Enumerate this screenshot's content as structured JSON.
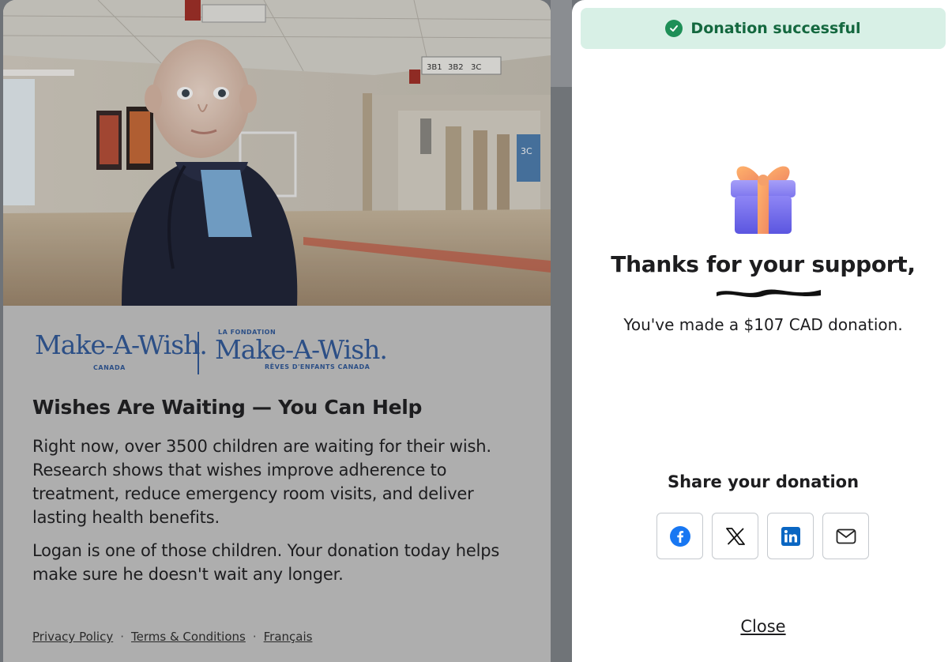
{
  "campaign": {
    "logo_en": {
      "wordmark": "Make-A-Wish.",
      "sub": "CANADA"
    },
    "logo_fr": {
      "above": "LA FONDATION",
      "wordmark": "Make-A-Wish.",
      "sub": "RÊVES D'ENFANTS CANADA"
    },
    "heading": "Wishes Are Waiting — You Can Help",
    "paragraph1": "Right now, over 3500 children are waiting for their wish. Research shows that wishes improve adherence to treatment, reduce emergency room visits, and deliver lasting health benefits.",
    "paragraph2": "Logan is one of those children. Your donation today helps make sure he doesn't wait any longer.",
    "footer_links": [
      "Privacy Policy",
      "Terms & Conditions",
      "Français"
    ],
    "footer_separator": "·",
    "hero_signs": [
      "3B1",
      "3B2",
      "3C",
      "3C"
    ]
  },
  "confirmation": {
    "toast": "Donation successful",
    "thanks": "Thanks for your support,",
    "message": "You've made a $107 CAD donation.",
    "share_title": "Share your donation",
    "share_buttons": [
      {
        "icon": "facebook-icon",
        "label": "Facebook"
      },
      {
        "icon": "x-icon",
        "label": "X"
      },
      {
        "icon": "linkedin-icon",
        "label": "LinkedIn"
      },
      {
        "icon": "email-icon",
        "label": "Email"
      }
    ],
    "close": "Close"
  },
  "colors": {
    "brand_blue": "#2c4f86",
    "success_bg": "#d8f0e6",
    "success_icon": "#1e8f57",
    "success_text": "#14683f",
    "facebook": "#1877f2",
    "linkedin": "#0a66c2"
  }
}
